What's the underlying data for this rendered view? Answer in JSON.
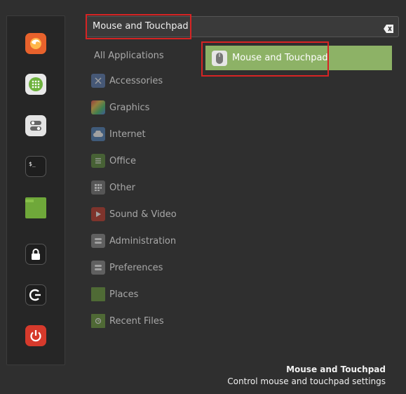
{
  "search": {
    "value": "Mouse and Touchpad"
  },
  "categories": {
    "all_label": "All Applications",
    "items": [
      {
        "label": "Accessories",
        "icon": "scissors-icon",
        "color": "#5a7bb0"
      },
      {
        "label": "Graphics",
        "icon": "palette-icon",
        "color": "#c44d9c"
      },
      {
        "label": "Internet",
        "icon": "cloud-icon",
        "color": "#4f7fb8"
      },
      {
        "label": "Office",
        "icon": "spreadsheet-icon",
        "color": "#5b8a3a"
      },
      {
        "label": "Other",
        "icon": "grid-icon",
        "color": "#777777"
      },
      {
        "label": "Sound & Video",
        "icon": "play-icon",
        "color": "#c0392b"
      },
      {
        "label": "Administration",
        "icon": "toggle-icon",
        "color": "#888888"
      },
      {
        "label": "Preferences",
        "icon": "sliders-icon",
        "color": "#888888"
      },
      {
        "label": "Places",
        "icon": "folder-icon",
        "color": "#6a9a3a"
      },
      {
        "label": "Recent Files",
        "icon": "recent-folder-icon",
        "color": "#6a9a3a"
      }
    ]
  },
  "result": {
    "label": "Mouse and Touchpad",
    "icon": "mouse-icon"
  },
  "description": {
    "title": "Mouse and Touchpad",
    "subtitle": "Control mouse and touchpad settings"
  },
  "favorites": [
    {
      "icon": "firefox-icon",
      "color": "#e8622c"
    },
    {
      "icon": "software-manager-icon",
      "color": "#6fb33f"
    },
    {
      "icon": "settings-icon",
      "color": "#e0e0e0"
    },
    {
      "icon": "terminal-icon",
      "color": "#1e1e1e"
    },
    {
      "icon": "files-icon",
      "color": "#6fa83a"
    },
    {
      "icon": "lock-screen-icon",
      "color": "#1e1e1e"
    },
    {
      "icon": "logout-icon",
      "color": "#1e1e1e"
    },
    {
      "icon": "shutdown-icon",
      "color": "#d63a2c"
    }
  ]
}
